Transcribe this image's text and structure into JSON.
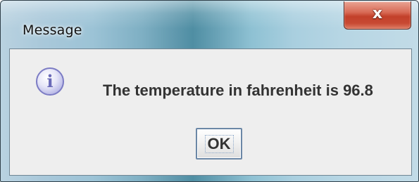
{
  "window": {
    "title": "Message",
    "close_icon": "close-icon",
    "close_glyph": "x"
  },
  "dialog": {
    "icon": "info-icon",
    "icon_glyph": "i",
    "message": "The temperature in fahrenheit is 96.8",
    "ok_label": "OK"
  },
  "colors": {
    "client_bg": "#eeeeee",
    "text": "#333333",
    "close_button": "#c2402a",
    "button_border": "#6b87a6"
  }
}
